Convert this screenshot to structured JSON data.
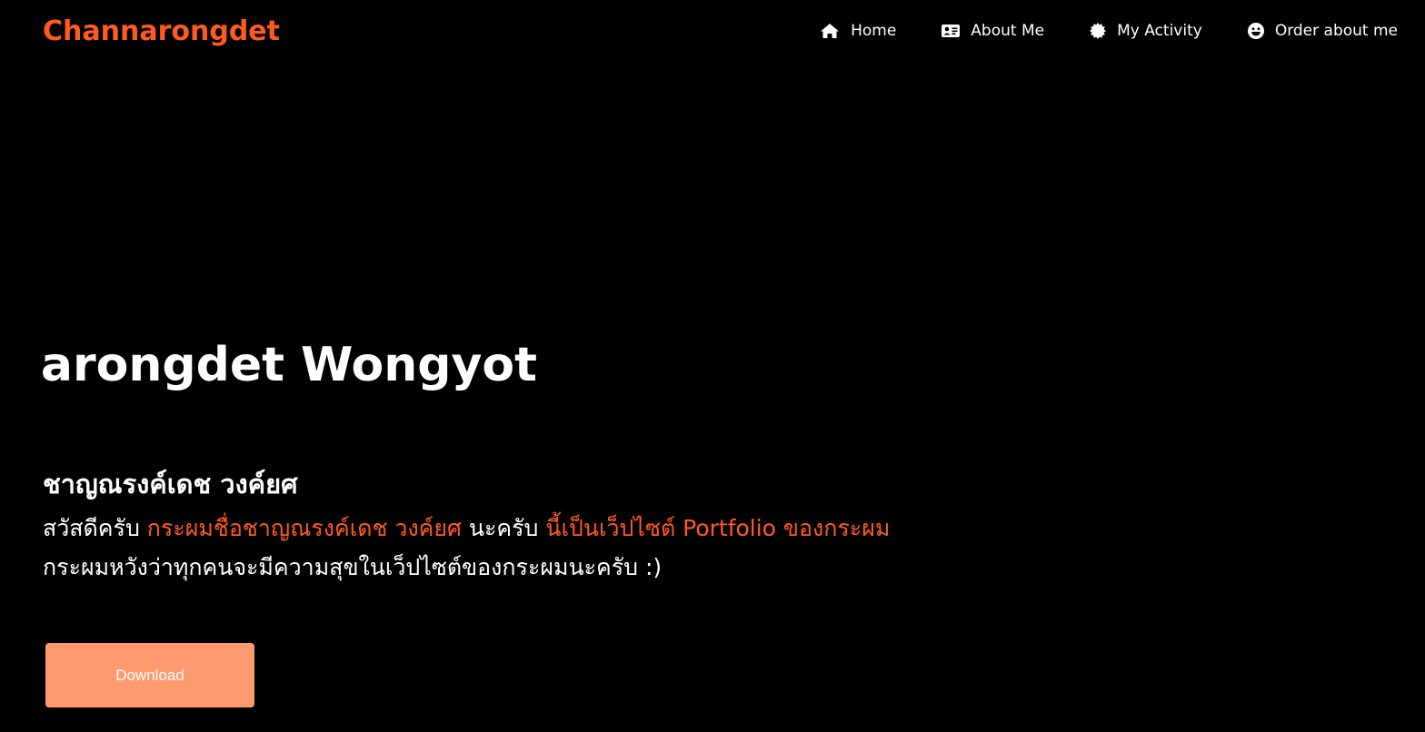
{
  "brand": {
    "name": "Channarongdet"
  },
  "nav": {
    "items": [
      {
        "label": "Home",
        "icon": "home-icon"
      },
      {
        "label": "About Me",
        "icon": "id-card-icon"
      },
      {
        "label": "My Activity",
        "icon": "badge-icon"
      },
      {
        "label": "Order about me",
        "icon": "smile-icon"
      }
    ]
  },
  "hero": {
    "name_en": "Channarongdet Wongyot",
    "name_th": "ชาญณรงค์เดช วงค์ยศ",
    "intro": {
      "part1": "สวัสดีครับ ",
      "part2": "กระผมชื่อชาญณรงค์เดช วงค์ยศ",
      "part3": " นะครับ ",
      "part4": "นี้เป็นเว็ปไซต์ Portfolio ของกระผม",
      "line2": "กระผมหวังว่าทุกคนจะมีความสุขในเว็ปไซต์ของกระผมนะครับ :)"
    },
    "download_label": "Download"
  },
  "colors": {
    "background": "#000000",
    "accent": "#ff5a1f",
    "button": "#ff9a6e",
    "text": "#ffffff"
  }
}
